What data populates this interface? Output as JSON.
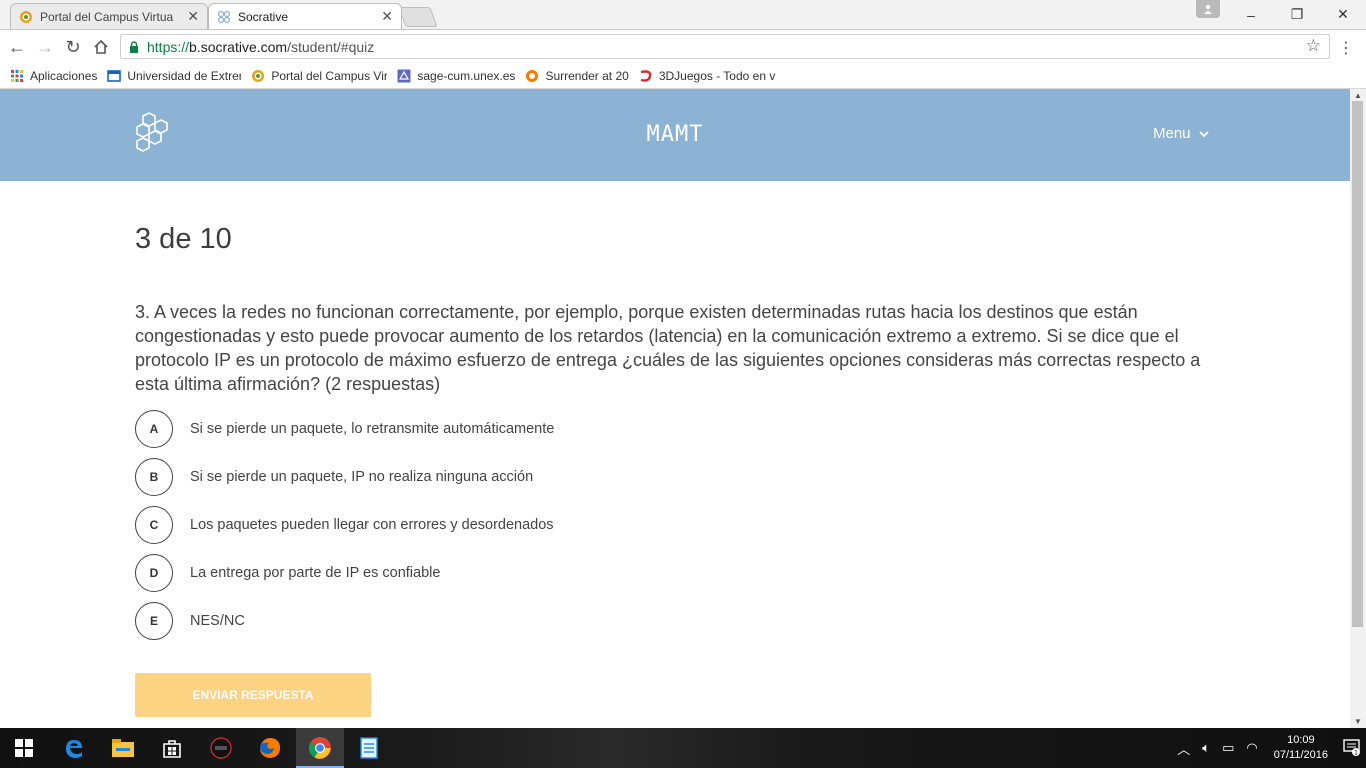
{
  "browser": {
    "tabs": [
      {
        "title": "Portal del Campus Virtua",
        "active": false
      },
      {
        "title": "Socrative",
        "active": true
      }
    ],
    "address": {
      "secure_part": "https://",
      "domain": "b.socrative.com",
      "path": "/student/#quiz"
    },
    "bookmarks": [
      {
        "label": "Aplicaciones",
        "icon": "apps-grid-icon"
      },
      {
        "label": "Universidad de Extren",
        "icon": "university-icon"
      },
      {
        "label": "Portal del Campus Vir",
        "icon": "campus-icon"
      },
      {
        "label": "sage-cum.unex.es",
        "icon": "sage-icon"
      },
      {
        "label": "Surrender at 20",
        "icon": "surrender-icon"
      },
      {
        "label": "3DJuegos - Todo en v",
        "icon": "3djuegos-icon"
      }
    ]
  },
  "app": {
    "room_name": "MAMT",
    "menu_label": "Menu"
  },
  "quiz": {
    "progress": "3 de 10",
    "question": "3. A veces la redes no funcionan correctamente, por ejemplo, porque existen determinadas rutas hacia los destinos que están congestionadas y esto puede provocar aumento de los retardos (latencia) en la comunicación extremo a extremo. Si se dice que el protocolo IP es un protocolo de máximo esfuerzo de entrega ¿cuáles de las siguientes opciones consideras más correctas respecto a esta última afirmación? (2 respuestas)",
    "answers": [
      {
        "letter": "A",
        "text": "Si se pierde un paquete, lo retransmite automáticamente"
      },
      {
        "letter": "B",
        "text": "Si se pierde un paquete, IP no realiza ninguna acción"
      },
      {
        "letter": "C",
        "text": "Los paquetes pueden llegar con errores y desordenados"
      },
      {
        "letter": "D",
        "text": "La entrega por parte de IP es confiable"
      },
      {
        "letter": "E",
        "text": "NES/NC"
      }
    ],
    "submit_label": "ENVIAR RESPUESTA"
  },
  "taskbar": {
    "time": "10:09",
    "date": "07/11/2016",
    "notification_count": "1"
  },
  "colors": {
    "header": "#8cb2d4",
    "submit_disabled": "#fcd283",
    "secure_green": "#0b8043"
  }
}
